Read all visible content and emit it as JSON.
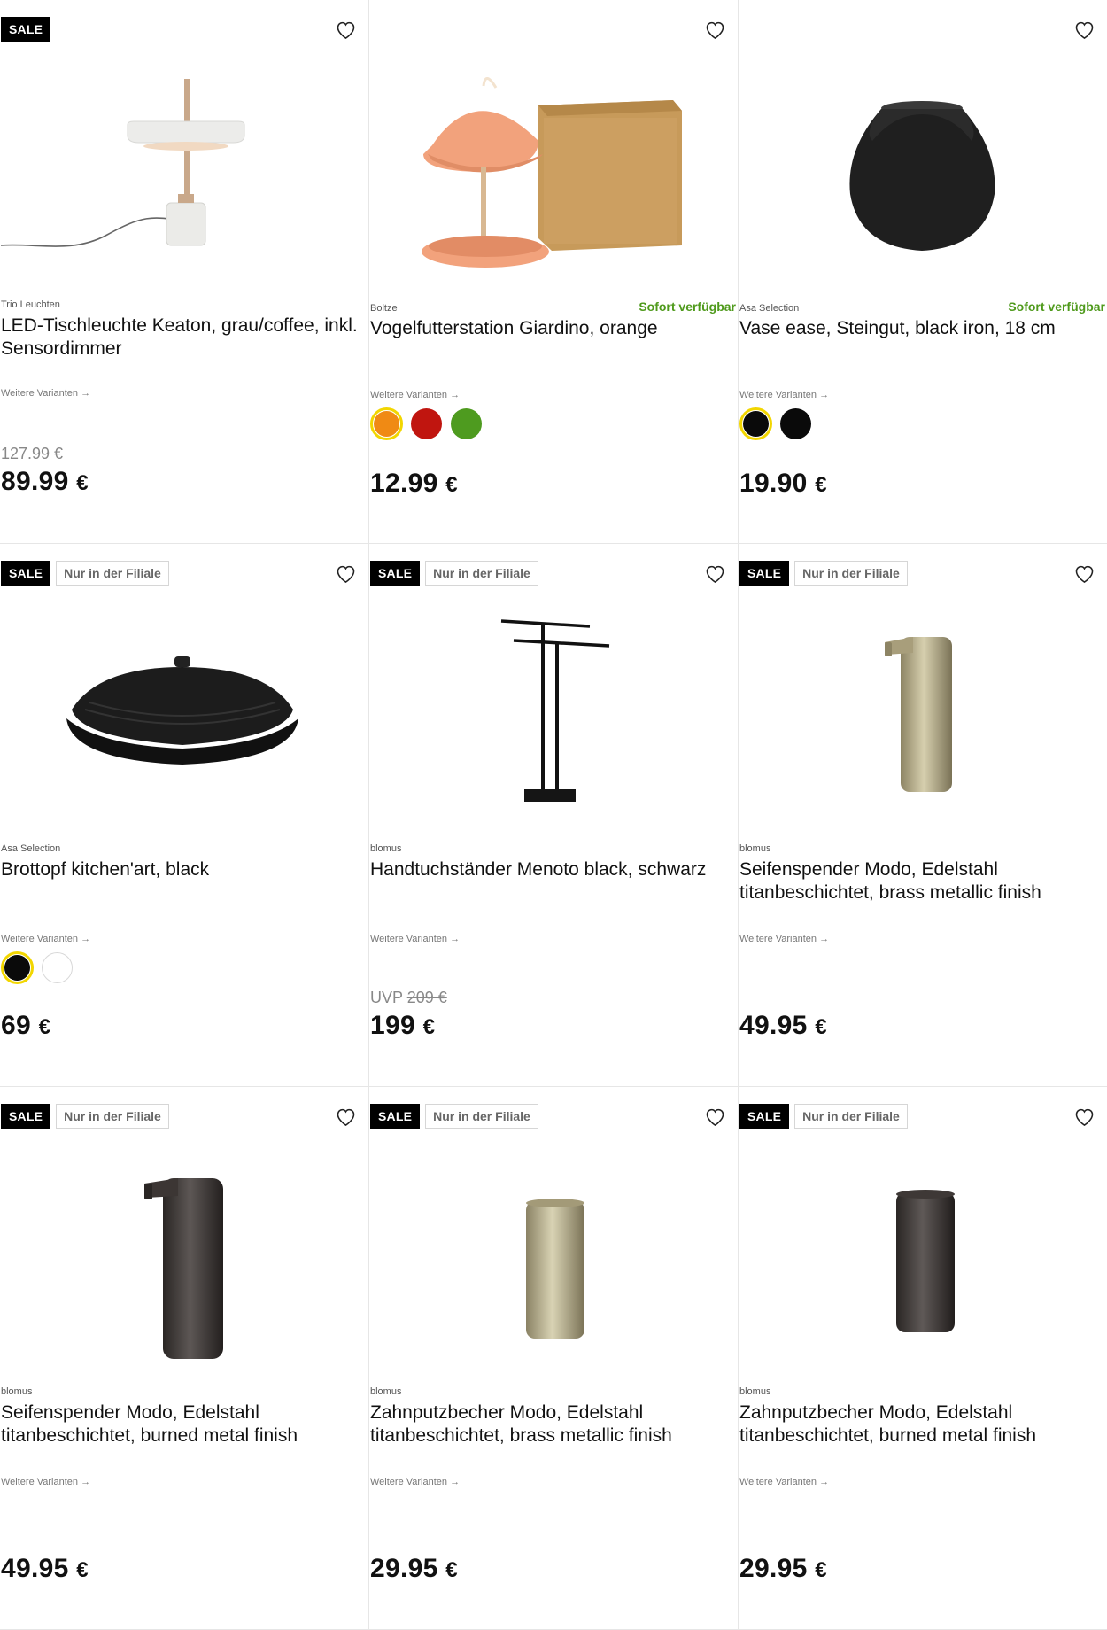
{
  "colors": {
    "sale_badge_bg": "#000000",
    "sofort_green": "#4f9a1c",
    "selected_ring": "#f2d600"
  },
  "labels": {
    "sale": "SALE",
    "nur_in_filiale": "Nur in der Filiale",
    "sofort": "Sofort verfügbar",
    "weitere_varianten": "Weitere Varianten →",
    "uvp": "UVP"
  },
  "products": [
    {
      "brand": "Trio Leuchten",
      "title": "LED-Tischleuchte Keaton, grau/coffee, inkl. Sensordimmer",
      "sale": true,
      "filiale": false,
      "sofort": false,
      "swatches": [],
      "old_price": "127.99 €",
      "price": "89.99",
      "currency": "€",
      "image_icon": "table-lamp-icon"
    },
    {
      "brand": "Boltze",
      "title": "Vogelfutterstation Giardino, orange",
      "sale": false,
      "filiale": false,
      "sofort": true,
      "swatches": [
        {
          "color": "#f08a14",
          "selected": true
        },
        {
          "color": "#c0150f",
          "selected": false
        },
        {
          "color": "#4e9b1f",
          "selected": false
        }
      ],
      "price": "12.99",
      "currency": "€",
      "image_icon": "bird-feeder-icon"
    },
    {
      "brand": "Asa Selection",
      "title": "Vase ease, Steingut, black iron, 18 cm",
      "sale": false,
      "filiale": false,
      "sofort": true,
      "swatches": [
        {
          "color": "#0a0a0a",
          "selected": true
        },
        {
          "color": "#0a0a0a",
          "selected": false
        }
      ],
      "price": "19.90",
      "currency": "€",
      "image_icon": "vase-icon"
    },
    {
      "brand": "Asa Selection",
      "title": "Brottopf kitchen'art, black",
      "sale": true,
      "filiale": true,
      "sofort": false,
      "swatches": [
        {
          "color": "#0a0a0a",
          "selected": true
        },
        {
          "color": "#ffffff",
          "selected": false
        }
      ],
      "price": "69",
      "currency": "€",
      "image_icon": "bread-pot-icon"
    },
    {
      "brand": "blomus",
      "title": "Handtuchständer Menoto black, schwarz",
      "sale": true,
      "filiale": true,
      "sofort": false,
      "swatches": [],
      "uvp_price": "209 €",
      "price": "199",
      "currency": "€",
      "image_icon": "towel-stand-icon"
    },
    {
      "brand": "blomus",
      "title": "Seifenspender Modo, Edelstahl titanbeschichtet, brass metallic finish",
      "sale": true,
      "filiale": true,
      "sofort": false,
      "swatches": [],
      "price": "49.95",
      "currency": "€",
      "image_icon": "soap-dispenser-brass-icon"
    },
    {
      "brand": "blomus",
      "title": "Seifenspender Modo, Edelstahl titanbeschichtet, burned metal finish",
      "sale": true,
      "filiale": true,
      "sofort": false,
      "swatches": [],
      "price": "49.95",
      "currency": "€",
      "image_icon": "soap-dispenser-dark-icon"
    },
    {
      "brand": "blomus",
      "title": "Zahnputzbecher Modo, Edelstahl titanbeschichtet, brass metallic finish",
      "sale": true,
      "filiale": true,
      "sofort": false,
      "swatches": [],
      "price": "29.95",
      "currency": "€",
      "image_icon": "tumbler-brass-icon"
    },
    {
      "brand": "blomus",
      "title": "Zahnputzbecher Modo, Edelstahl titanbeschichtet, burned metal finish",
      "sale": true,
      "filiale": true,
      "sofort": false,
      "swatches": [],
      "price": "29.95",
      "currency": "€",
      "image_icon": "tumbler-dark-icon"
    }
  ]
}
